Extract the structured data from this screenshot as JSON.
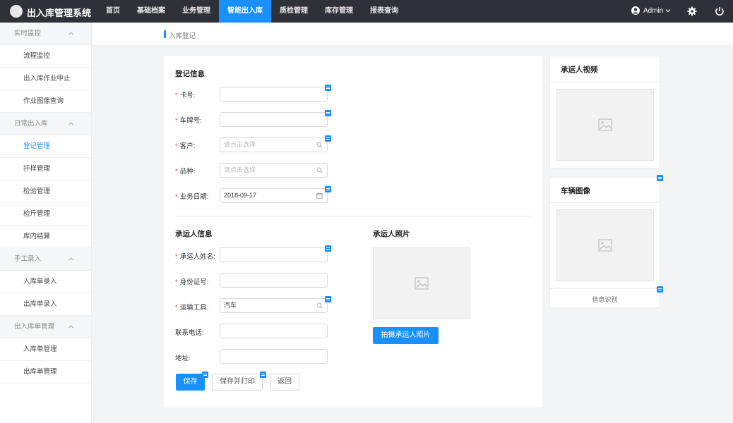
{
  "app": {
    "title": "出入库管理系统"
  },
  "nav": [
    "首页",
    "基础档案",
    "业务管理",
    "智能出入库",
    "质检管理",
    "库存管理",
    "报表查询"
  ],
  "nav_active_index": 3,
  "user": {
    "name": "Admin"
  },
  "sidebar": {
    "groups": [
      {
        "label": "实时监控",
        "items": [
          "流程监控",
          "出入库作业中止",
          "作业图像查询"
        ]
      },
      {
        "label": "日常出入库",
        "items": [
          "登记管理",
          "扦样管理",
          "检验管理",
          "检斤管理",
          "库内结算"
        ]
      },
      {
        "label": "手工录入",
        "items": [
          "入库单录入",
          "出库单录入"
        ]
      },
      {
        "label": "出入库单管理",
        "items": [
          "入库单管理",
          "出库单管理"
        ]
      }
    ],
    "active_item": "登记管理"
  },
  "breadcrumb": "入库登记",
  "registration": {
    "title": "登记信息",
    "fields": {
      "card_no": {
        "label": "卡号:",
        "value": ""
      },
      "plate_no": {
        "label": "车牌号:",
        "value": ""
      },
      "customer": {
        "label": "客户:",
        "placeholder": "请点击选择"
      },
      "variety": {
        "label": "品种:",
        "placeholder": "请点击选择"
      },
      "biz_date": {
        "label": "业务日期:",
        "value": "2018-09-17"
      }
    }
  },
  "carrier": {
    "title": "承运人信息",
    "fields": {
      "name": {
        "label": "承运人姓名:",
        "value": ""
      },
      "id_no": {
        "label": "身份证号:",
        "value": ""
      },
      "transport": {
        "label": "运输工具:",
        "value": "汽车"
      },
      "phone": {
        "label": "联系电话:",
        "value": ""
      },
      "address": {
        "label": "地址:",
        "value": ""
      }
    },
    "photo_title": "承运人照片",
    "capture_button": "拍摄承运人照片"
  },
  "actions": {
    "save": "保存",
    "save_print": "保存并打印",
    "back": "返回"
  },
  "right": {
    "video_title": "承运人视频",
    "vehicle_title": "车辆图像",
    "recognize": "信息识别"
  },
  "colors": {
    "primary": "#1a90ff",
    "topbar": "#2f3138",
    "required": "#e4393c"
  }
}
